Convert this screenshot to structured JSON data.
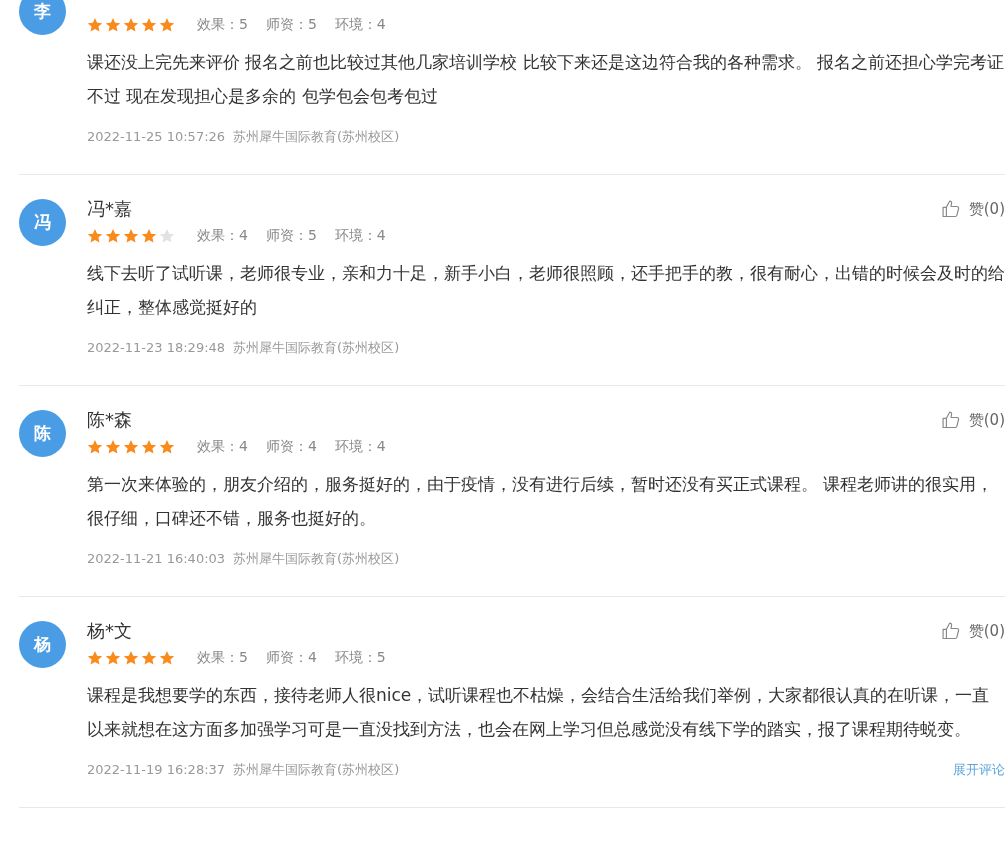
{
  "reviews": [
    {
      "avatar": "李",
      "stars": 5,
      "scores": [
        "效果：5",
        "师资：5",
        "环境：4"
      ],
      "text": "课还没上完先来评价 报名之前也比较过其他几家培训学校 比较下来还是这边符合我的各种需求。 报名之前还担心学完考证不过 现在发现担心是多余的 包学包会包考包过",
      "date": "2022-11-25 10:57:26",
      "school": "苏州犀牛国际教育(苏州校区)"
    },
    {
      "avatar": "冯",
      "name": "冯*嘉",
      "likes": "赞(0)",
      "stars": 4,
      "scores": [
        "效果：4",
        "师资：5",
        "环境：4"
      ],
      "text": "线下去听了试听课，老师很专业，亲和力十足，新手小白，老师很照顾，还手把手的教，很有耐心，出错的时候会及时的给纠正，整体感觉挺好的",
      "date": "2022-11-23 18:29:48",
      "school": "苏州犀牛国际教育(苏州校区)"
    },
    {
      "avatar": "陈",
      "name": "陈*森",
      "likes": "赞(0)",
      "stars": 5,
      "scores": [
        "效果：4",
        "师资：4",
        "环境：4"
      ],
      "text": "第一次来体验的，朋友介绍的，服务挺好的，由于疫情，没有进行后续，暂时还没有买正式课程。 课程老师讲的很实用，很仔细，口碑还不错，服务也挺好的。",
      "date": "2022-11-21 16:40:03",
      "school": "苏州犀牛国际教育(苏州校区)"
    },
    {
      "avatar": "杨",
      "name": "杨*文",
      "likes": "赞(0)",
      "stars": 5,
      "scores": [
        "效果：5",
        "师资：4",
        "环境：5"
      ],
      "text": "课程是我想要学的东西，接待老师人很nice，试听课程也不枯燥，会结合生活给我们举例，大家都很认真的在听课，一直以来就想在这方面多加强学习可是一直没找到方法，也会在网上学习但总感觉没有线下学的踏实，报了课程期待蜕变。",
      "date": "2022-11-19 16:28:37",
      "school": "苏州犀牛国际教育(苏州校区)"
    }
  ],
  "expand_link": "展开评论"
}
